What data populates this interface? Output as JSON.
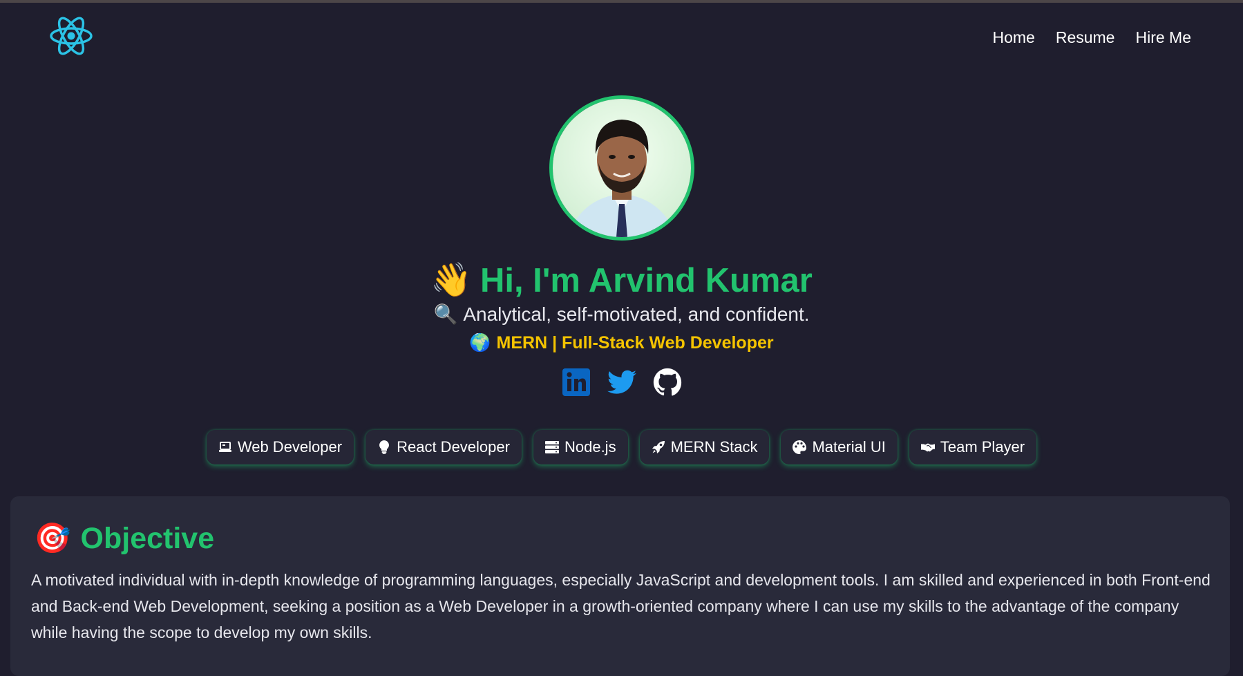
{
  "nav": {
    "logo_icon": "react-atom-icon",
    "links": [
      "Home",
      "Resume",
      "Hire Me"
    ]
  },
  "hero": {
    "avatar_alt": "profile-photo",
    "wave_emoji": "👋",
    "greeting": "Hi, I'm Arvind Kumar",
    "tagline_emoji": "🔍",
    "tagline": "Analytical, self-motivated, and confident.",
    "role_emoji": "🌍",
    "role": "MERN | Full-Stack Web Developer",
    "socials": [
      "linkedin-icon",
      "twitter-icon",
      "github-icon"
    ]
  },
  "chips": [
    {
      "icon": "laptop-icon",
      "label": "Web Developer"
    },
    {
      "icon": "lightbulb-icon",
      "label": "React Developer"
    },
    {
      "icon": "server-icon",
      "label": "Node.js"
    },
    {
      "icon": "rocket-icon",
      "label": "MERN Stack"
    },
    {
      "icon": "palette-icon",
      "label": "Material UI"
    },
    {
      "icon": "handshake-icon",
      "label": "Team Player"
    }
  ],
  "objective": {
    "emoji": "🎯",
    "title": "Objective",
    "text": "A motivated individual with in-depth knowledge of programming languages, especially JavaScript and development tools. I am skilled and experienced in both Front-end and Back-end Web Development, seeking a position as a Web Developer in a growth-oriented company where I can use my skills to the advantage of the company while having the scope to develop my own skills."
  },
  "colors": {
    "background": "#1f1e2e",
    "accent_green": "#22c36e",
    "accent_yellow": "#f5c400",
    "card": "#292a3a",
    "linkedin": "#0a66c2",
    "twitter": "#1d9bf0"
  }
}
